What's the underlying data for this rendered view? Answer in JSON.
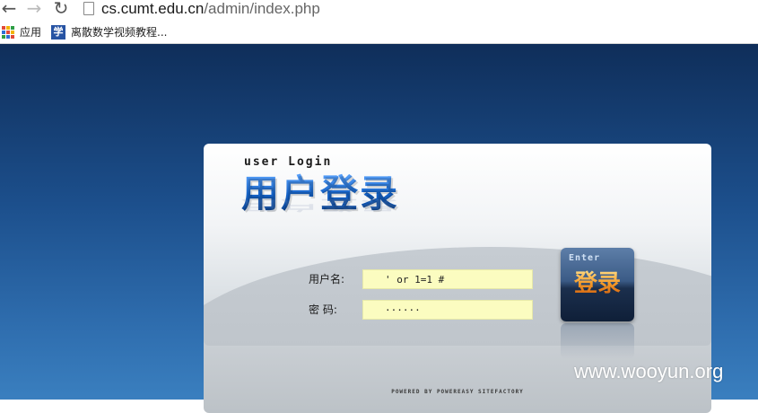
{
  "browser": {
    "url_domain": "cs.cumt.edu.cn",
    "url_path": "/admin/index.php",
    "icons": [
      "back-arrow-icon",
      "forward-arrow-icon",
      "reload-icon",
      "page-document-icon"
    ]
  },
  "bookmarks": {
    "apps_label": "应用",
    "item1_label": "离散数学视频教程...",
    "item1_icon": "学"
  },
  "login": {
    "subtitle": "user Login",
    "title": "用户登录",
    "username_label": "用户名:",
    "username_value": "' or 1=1 #",
    "password_label": "密 码:",
    "password_value": "······",
    "enter_label": "Enter",
    "enter_cn": "登录",
    "footer": "POWERED BY POWEREASY SITEFACTORY"
  },
  "watermark": "www.wooyun.org",
  "colors": {
    "page_top": "#0f2e5a",
    "page_bottom": "#3a7fbf",
    "field_bg": "#fbfcc0",
    "title_blue": "#1563c8",
    "enter_orange": "#f59a28"
  }
}
